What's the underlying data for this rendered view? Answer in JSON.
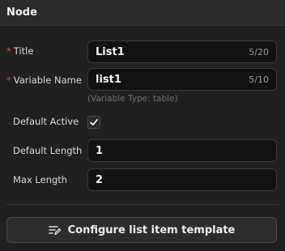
{
  "header": {
    "title": "Node"
  },
  "fields": {
    "title": {
      "label": "Title",
      "value": "List1",
      "counter": "5/20"
    },
    "variable_name": {
      "label": "Variable Name",
      "value": "list1",
      "counter": "5/10",
      "hint": "(Variable Type: table)"
    },
    "default_active": {
      "label": "Default Active",
      "checked": true
    },
    "default_length": {
      "label": "Default Length",
      "value": "1"
    },
    "max_length": {
      "label": "Max Length",
      "value": "2"
    }
  },
  "button": {
    "label": "Configure list item template",
    "icon": "list-edit-icon"
  },
  "colors": {
    "required": "#e5484d",
    "background": "#202020",
    "input_bg": "#121212"
  }
}
